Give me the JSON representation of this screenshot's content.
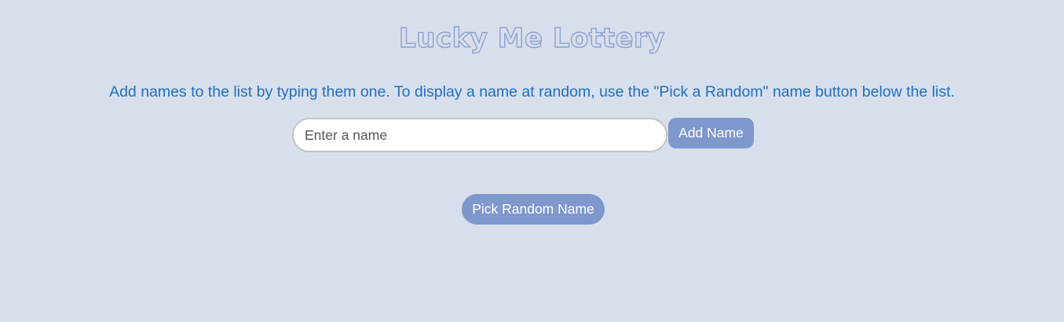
{
  "header": {
    "title": "Lucky Me Lottery"
  },
  "instructions": "Add names to the list by typing them one. To display a name at random, use the \"Pick a Random\" name button below the list.",
  "form": {
    "name_input_value": "",
    "name_input_placeholder": "Enter a name",
    "add_button_label": "Add Name"
  },
  "name_list": [],
  "pick_button_label": "Pick Random Name",
  "colors": {
    "background": "#d8dfec",
    "accent_button": "#7e97cd",
    "instruction_text": "#1f6fbd",
    "title_outline": "#8ba1cf"
  }
}
